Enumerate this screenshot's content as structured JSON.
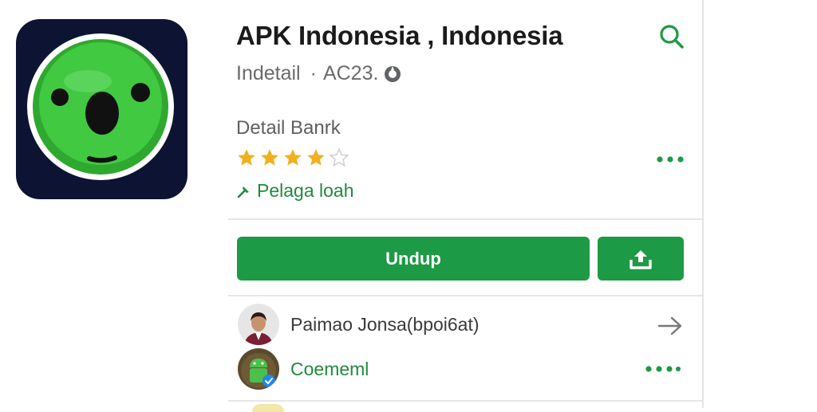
{
  "app": {
    "title": "APK Indonesia , Indonesia",
    "developer": "Indetail",
    "separator": "·",
    "code": "AC23.",
    "detail_label": "Detail Banrk",
    "rating_stars": 4,
    "rating_max": 5,
    "tag": "Pelaga loah"
  },
  "actions": {
    "download_label": "Undup"
  },
  "list": {
    "items": [
      {
        "label": "Paimao Jonsa(bpoi6at)"
      },
      {
        "label": "Coememl"
      }
    ]
  },
  "icons": {
    "search": "search-icon",
    "verified": "verified-badge-icon",
    "more": "more-dots-icon",
    "share": "share-upload-icon",
    "arrow": "arrow-right-icon",
    "tag": "pin-icon"
  },
  "colors": {
    "accent": "#1d9a45",
    "star": "#f2b01e",
    "icon_bg": "#0d1433",
    "icon_face": "#3cc23c"
  }
}
